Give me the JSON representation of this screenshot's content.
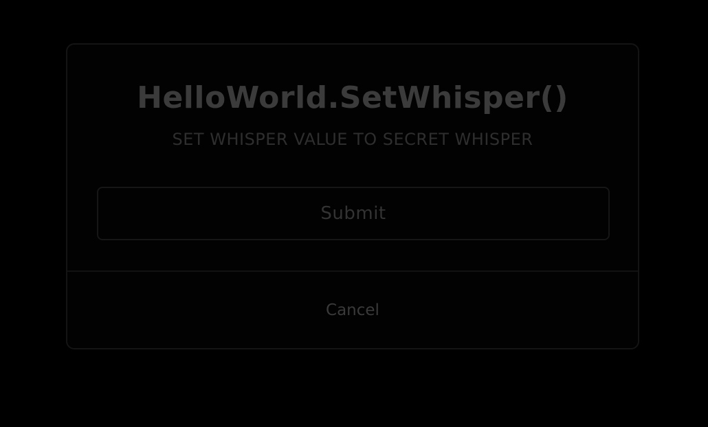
{
  "dialog": {
    "title": "HelloWorld.SetWhisper()",
    "subtitle": "SET WHISPER VALUE TO SECRET WHISPER",
    "submit_label": "Submit",
    "cancel_label": "Cancel"
  },
  "colors": {
    "background": "#000000",
    "border": "#141414",
    "title_text": "#3b3b3b",
    "subtitle_text": "#2e2e2e"
  }
}
